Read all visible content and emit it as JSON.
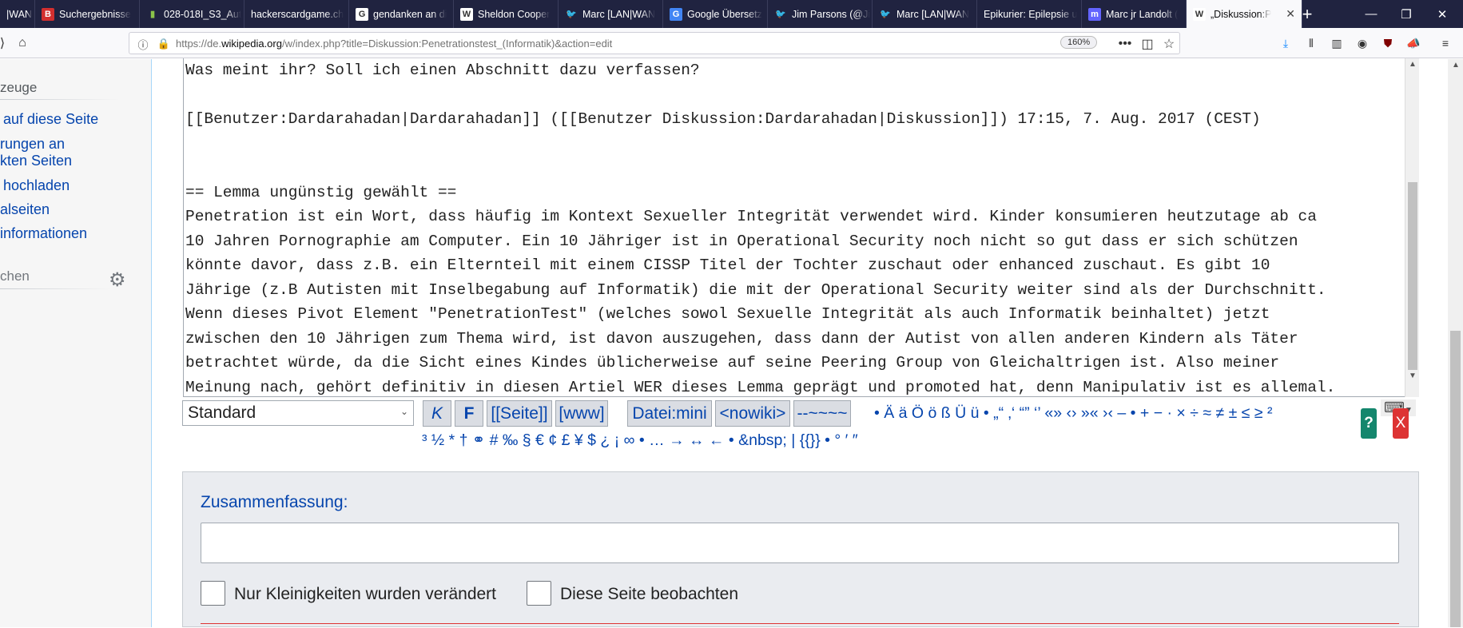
{
  "browser": {
    "tabs": [
      {
        "label": "|WAN",
        "favicon": "tab-fragment",
        "fav_color": "#202340"
      },
      {
        "label": "Suchergebnisse",
        "favicon": "B",
        "fav_color": "#d32f2f"
      },
      {
        "label": "028-018I_S3_Aut",
        "favicon": "doc",
        "fav_color": "#8bc34a"
      },
      {
        "label": "hackerscardgame.ch",
        "favicon": "",
        "fav_color": "#202340"
      },
      {
        "label": "gendanken an di",
        "favicon": "G",
        "fav_color": "#ffffff"
      },
      {
        "label": "Sheldon Cooper",
        "favicon": "W",
        "fav_color": "#ffffff"
      },
      {
        "label": "Marc [LAN|WAN",
        "favicon": "twitter-bird",
        "fav_color": "#1da1f2"
      },
      {
        "label": "Google Übersetz",
        "favicon": "G",
        "fav_color": "#4285f4"
      },
      {
        "label": "Jim Parsons (@Ji",
        "favicon": "twitter-bird",
        "fav_color": "#1da1f2"
      },
      {
        "label": "Marc [LAN|WAN",
        "favicon": "twitter-bird",
        "fav_color": "#1da1f2"
      },
      {
        "label": "Epikurier: Epilepsie u",
        "favicon": "",
        "fav_color": "#202340"
      },
      {
        "label": "Marc jr Landolt (",
        "favicon": "m",
        "fav_color": "#6364ff"
      },
      {
        "label": "„Diskussion:P",
        "favicon": "W",
        "fav_color": "#ffffff"
      }
    ],
    "url_prefix": "https://de.",
    "url_domain": "wikipedia.org",
    "url_rest": "/w/index.php?title=Diskussion:Penetrationstest_(Informatik)&action=edit",
    "zoom": "160%"
  },
  "sidebar": {
    "heading": "zeuge",
    "links": [
      "auf diese Seite",
      "rungen an",
      "kten Seiten",
      "hochladen",
      "alseiten",
      "informationen"
    ],
    "search_label": "chen"
  },
  "editor": {
    "lines": [
      "Was meint ihr? Soll ich einen Abschnitt dazu verfassen?",
      "",
      "[[Benutzer:Dardarahadan|Dardarahadan]] ([[Benutzer Diskussion:Dardarahadan|Diskussion]]) 17:15, 7. Aug. 2017 (CEST)",
      "",
      "",
      "== Lemma ungünstig gewählt ==",
      "Penetration ist ein Wort, dass häufig im Kontext Sexueller Integrität verwendet wird. Kinder konsumieren heutzutage ab ca",
      "10 Jahren Pornographie am Computer. Ein 10 Jähriger ist in Operational Security noch nicht so gut dass er sich schützen",
      "könnte davor, dass z.B. ein Elternteil mit einem CISSP Titel der Tochter zuschaut oder enhanced zuschaut. Es gibt 10",
      "Jährige (z.B Autisten mit Inselbegabung auf Informatik) die mit der Operational Security weiter sind als der Durchschnitt.",
      "Wenn dieses Pivot Element \"PenetrationTest\" (welches sowol Sexuelle Integrität als auch Informatik beinhaltet) jetzt",
      "zwischen den 10 Jährigen zum Thema wird, ist davon auszugehen, dass dann der Autist von allen anderen Kindern als Täter",
      "betrachtet würde, da die Sicht eines Kindes üblicherweise auf seine Peering Group von Gleichaltrigen ist. Also meiner",
      "Meinung nach, gehört definitiv in diesen Artiel WER dieses Lemma geprägt und promoted hat, denn Manipulativ ist es allemal."
    ]
  },
  "toolbar": {
    "select_value": "Standard",
    "buttons": [
      "K",
      "F",
      "[[Seite]]",
      "[www]",
      "Datei:mini",
      "<nowiki>",
      "--~~~~"
    ],
    "chars_row1": "• Ä ä Ö ö ß Ü ü • „“ ‚‘ “” ‘’ «» ‹› »« ›‹ – • + − · × ÷ ≈ ≠ ± ≤ ≥ ²",
    "chars_row2": "³ ½ * † ⚭ # ‰ § € ¢ £ ¥ $ ¿ ¡ ∞ • … → ↔ ← • &nbsp; | {{}} • ° ′ ″",
    "help_label": "?",
    "close_label": "X"
  },
  "summary": {
    "label": "Zusammenfassung:",
    "value": "",
    "minor_label": "Nur Kleinigkeiten wurden verändert",
    "watch_label": "Diese Seite beobachten"
  }
}
